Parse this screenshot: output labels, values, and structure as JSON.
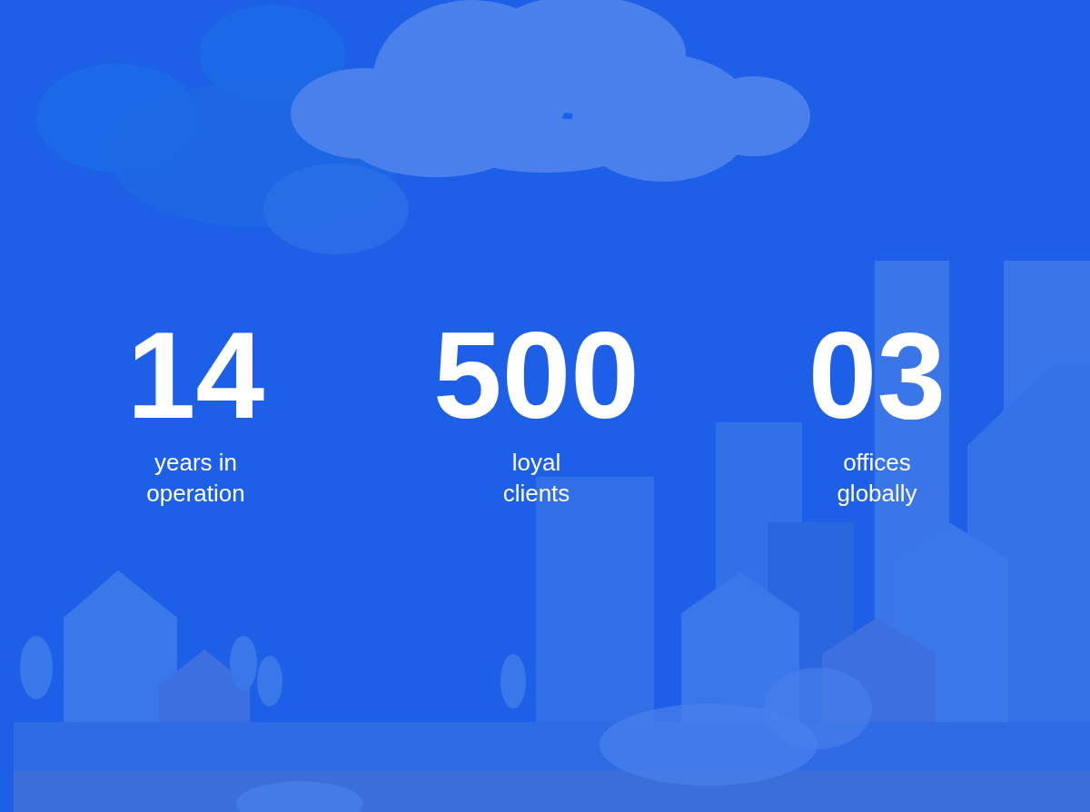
{
  "stats": [
    {
      "value": "14",
      "label_lines": [
        "years in",
        "operation"
      ]
    },
    {
      "value": "500",
      "label_lines": [
        "loyal",
        "clients"
      ]
    },
    {
      "value": "03",
      "label_lines": [
        "offices",
        "globally"
      ]
    }
  ]
}
